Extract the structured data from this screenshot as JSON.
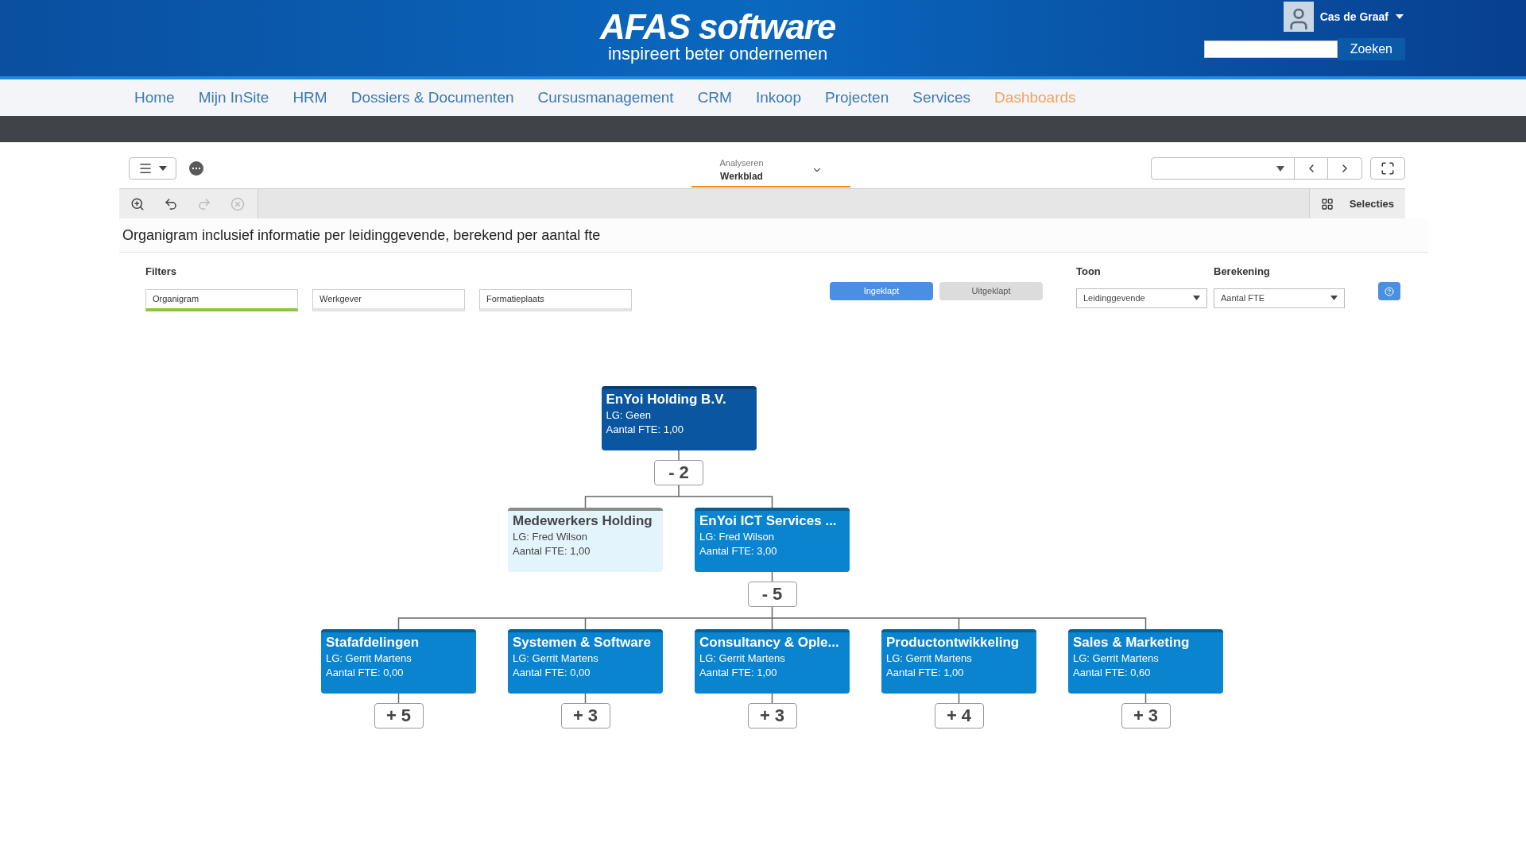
{
  "header": {
    "logo_title": "AFAS software",
    "logo_tagline": "inspireert beter ondernemen",
    "user_name": "Cas de Graaf",
    "search_button": "Zoeken"
  },
  "nav": [
    {
      "label": "Home",
      "selected": false
    },
    {
      "label": "Mijn InSite",
      "selected": false
    },
    {
      "label": "HRM",
      "selected": false
    },
    {
      "label": "Dossiers & Documenten",
      "selected": false
    },
    {
      "label": "Cursusmanagement",
      "selected": false
    },
    {
      "label": "CRM",
      "selected": false
    },
    {
      "label": "Inkoop",
      "selected": false
    },
    {
      "label": "Projecten",
      "selected": false
    },
    {
      "label": "Services",
      "selected": false
    },
    {
      "label": "Dashboards",
      "selected": true
    }
  ],
  "toolbar": {
    "tab_caption": "Analyseren",
    "tab_title": "Werkblad",
    "selections_label": "Selecties"
  },
  "sheet_title": "Organigram inclusief informatie per leidinggevende, berekend per aantal fte",
  "filters": {
    "label": "Filters",
    "fields": [
      {
        "label": "Organigram",
        "selected": true
      },
      {
        "label": "Werkgever",
        "selected": false
      },
      {
        "label": "Formatieplaats",
        "selected": false
      }
    ]
  },
  "view_buttons": [
    {
      "label": "Ingeklapt",
      "selected": true
    },
    {
      "label": "Uitgeklapt",
      "selected": false
    }
  ],
  "toon": {
    "label": "Toon",
    "value": "Leidinggevende"
  },
  "berekening": {
    "label": "Berekening",
    "value": "Aantal FTE"
  },
  "org_chart": {
    "name": "EnYoi Holding B.V.",
    "manager": "LG: Geen",
    "fte": "Aantal FTE: 1,00",
    "kind": "root",
    "toggle": "- 2",
    "children": [
      {
        "name": "Medewerkers Holding",
        "manager": "LG: Fred Wilson",
        "fte": "Aantal FTE: 1,00",
        "kind": "staff"
      },
      {
        "name": "EnYoi ICT Services ...",
        "manager": "LG: Fred Wilson",
        "fte": "Aantal FTE: 3,00",
        "kind": "unit",
        "toggle": "- 5",
        "children": [
          {
            "name": "Stafafdelingen",
            "manager": "LG: Gerrit Martens",
            "fte": "Aantal FTE: 0,00",
            "kind": "unit",
            "toggle": "+ 5"
          },
          {
            "name": "Systemen & Software",
            "manager": "LG: Gerrit Martens",
            "fte": "Aantal FTE: 0,00",
            "kind": "unit",
            "toggle": "+ 3"
          },
          {
            "name": "Consultancy & Ople...",
            "manager": "LG: Gerrit Martens",
            "fte": "Aantal FTE: 1,00",
            "kind": "unit",
            "toggle": "+ 3"
          },
          {
            "name": "Productontwikkeling",
            "manager": "LG: Gerrit Martens",
            "fte": "Aantal FTE: 1,00",
            "kind": "unit",
            "toggle": "+ 4"
          },
          {
            "name": "Sales & Marketing",
            "manager": "LG: Gerrit Martens",
            "fte": "Aantal FTE: 0,60",
            "kind": "unit",
            "toggle": "+ 3"
          }
        ]
      }
    ]
  }
}
